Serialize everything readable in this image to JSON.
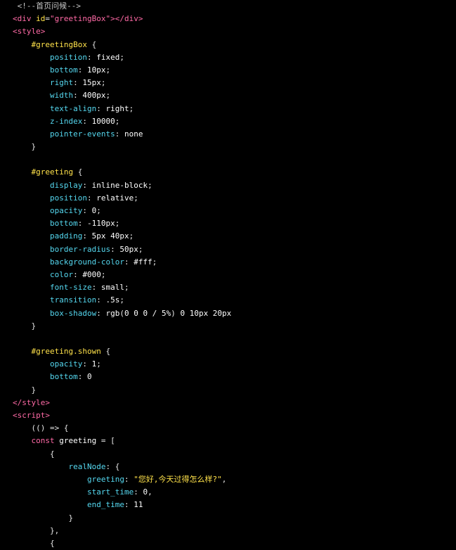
{
  "editor": {
    "background": "#000000",
    "colors": {
      "tag": "#ff6aa6",
      "attribute": "#ffe24a",
      "selector": "#ffe24a",
      "property": "#55d8f0",
      "value": "#ffffff",
      "comment": "#c8c8c8"
    },
    "lines": [
      [
        [
          "comment",
          " <!--首页问候-->"
        ]
      ],
      [
        [
          "tag",
          "<div"
        ],
        [
          "punct",
          " "
        ],
        [
          "attr",
          "id"
        ],
        [
          "punct",
          "="
        ],
        [
          "string",
          "\"greetingBox\""
        ],
        [
          "tag",
          "></div>"
        ]
      ],
      [
        [
          "tag",
          "<style>"
        ]
      ],
      [
        [
          "punct",
          "    "
        ],
        [
          "selector",
          "#greetingBox"
        ],
        [
          "punct",
          " {"
        ]
      ],
      [
        [
          "punct",
          "        "
        ],
        [
          "prop",
          "position"
        ],
        [
          "punct",
          ": "
        ],
        [
          "value",
          "fixed"
        ],
        [
          "punct",
          ";"
        ]
      ],
      [
        [
          "punct",
          "        "
        ],
        [
          "prop",
          "bottom"
        ],
        [
          "punct",
          ": "
        ],
        [
          "value",
          "10px"
        ],
        [
          "punct",
          ";"
        ]
      ],
      [
        [
          "punct",
          "        "
        ],
        [
          "prop",
          "right"
        ],
        [
          "punct",
          ": "
        ],
        [
          "value",
          "15px"
        ],
        [
          "punct",
          ";"
        ]
      ],
      [
        [
          "punct",
          "        "
        ],
        [
          "prop",
          "width"
        ],
        [
          "punct",
          ": "
        ],
        [
          "value",
          "400px"
        ],
        [
          "punct",
          ";"
        ]
      ],
      [
        [
          "punct",
          "        "
        ],
        [
          "prop",
          "text-align"
        ],
        [
          "punct",
          ": "
        ],
        [
          "value",
          "right"
        ],
        [
          "punct",
          ";"
        ]
      ],
      [
        [
          "punct",
          "        "
        ],
        [
          "prop",
          "z-index"
        ],
        [
          "punct",
          ": "
        ],
        [
          "value",
          "10000"
        ],
        [
          "punct",
          ";"
        ]
      ],
      [
        [
          "punct",
          "        "
        ],
        [
          "prop",
          "pointer-events"
        ],
        [
          "punct",
          ": "
        ],
        [
          "value",
          "none"
        ]
      ],
      [
        [
          "punct",
          "    }"
        ]
      ],
      [
        [
          "punct",
          ""
        ]
      ],
      [
        [
          "punct",
          "    "
        ],
        [
          "selector",
          "#greeting"
        ],
        [
          "punct",
          " {"
        ]
      ],
      [
        [
          "punct",
          "        "
        ],
        [
          "prop",
          "display"
        ],
        [
          "punct",
          ": "
        ],
        [
          "value",
          "inline-block"
        ],
        [
          "punct",
          ";"
        ]
      ],
      [
        [
          "punct",
          "        "
        ],
        [
          "prop",
          "position"
        ],
        [
          "punct",
          ": "
        ],
        [
          "value",
          "relative"
        ],
        [
          "punct",
          ";"
        ]
      ],
      [
        [
          "punct",
          "        "
        ],
        [
          "prop",
          "opacity"
        ],
        [
          "punct",
          ": "
        ],
        [
          "value",
          "0"
        ],
        [
          "punct",
          ";"
        ]
      ],
      [
        [
          "punct",
          "        "
        ],
        [
          "prop",
          "bottom"
        ],
        [
          "punct",
          ": "
        ],
        [
          "value",
          "-110px"
        ],
        [
          "punct",
          ";"
        ]
      ],
      [
        [
          "punct",
          "        "
        ],
        [
          "prop",
          "padding"
        ],
        [
          "punct",
          ": "
        ],
        [
          "value",
          "5px 40px"
        ],
        [
          "punct",
          ";"
        ]
      ],
      [
        [
          "punct",
          "        "
        ],
        [
          "prop",
          "border-radius"
        ],
        [
          "punct",
          ": "
        ],
        [
          "value",
          "50px"
        ],
        [
          "punct",
          ";"
        ]
      ],
      [
        [
          "punct",
          "        "
        ],
        [
          "prop",
          "background-color"
        ],
        [
          "punct",
          ": "
        ],
        [
          "value",
          "#fff"
        ],
        [
          "punct",
          ";"
        ]
      ],
      [
        [
          "punct",
          "        "
        ],
        [
          "prop",
          "color"
        ],
        [
          "punct",
          ": "
        ],
        [
          "value",
          "#000"
        ],
        [
          "punct",
          ";"
        ]
      ],
      [
        [
          "punct",
          "        "
        ],
        [
          "prop",
          "font-size"
        ],
        [
          "punct",
          ": "
        ],
        [
          "value",
          "small"
        ],
        [
          "punct",
          ";"
        ]
      ],
      [
        [
          "punct",
          "        "
        ],
        [
          "prop",
          "transition"
        ],
        [
          "punct",
          ": "
        ],
        [
          "value",
          ".5s"
        ],
        [
          "punct",
          ";"
        ]
      ],
      [
        [
          "punct",
          "        "
        ],
        [
          "prop",
          "box-shadow"
        ],
        [
          "punct",
          ": "
        ],
        [
          "value",
          "rgb"
        ],
        [
          "punct",
          "("
        ],
        [
          "value",
          "0 0 0 / 5%"
        ],
        [
          "punct",
          ") "
        ],
        [
          "value",
          "0 10px 20px"
        ]
      ],
      [
        [
          "punct",
          "    }"
        ]
      ],
      [
        [
          "punct",
          ""
        ]
      ],
      [
        [
          "punct",
          "    "
        ],
        [
          "selector",
          "#greeting.shown"
        ],
        [
          "punct",
          " {"
        ]
      ],
      [
        [
          "punct",
          "        "
        ],
        [
          "prop",
          "opacity"
        ],
        [
          "punct",
          ": "
        ],
        [
          "value",
          "1"
        ],
        [
          "punct",
          ";"
        ]
      ],
      [
        [
          "punct",
          "        "
        ],
        [
          "prop",
          "bottom"
        ],
        [
          "punct",
          ": "
        ],
        [
          "value",
          "0"
        ]
      ],
      [
        [
          "punct",
          "    }"
        ]
      ],
      [
        [
          "tag",
          "</style>"
        ]
      ],
      [
        [
          "tag",
          "<script>"
        ]
      ],
      [
        [
          "punct",
          "    (() => {"
        ]
      ],
      [
        [
          "punct",
          "    "
        ],
        [
          "keyword",
          "const"
        ],
        [
          "punct",
          " "
        ],
        [
          "ident",
          "greeting"
        ],
        [
          "punct",
          " = ["
        ]
      ],
      [
        [
          "punct",
          "        {"
        ]
      ],
      [
        [
          "punct",
          "            "
        ],
        [
          "key",
          "realNode"
        ],
        [
          "punct",
          ": {"
        ]
      ],
      [
        [
          "punct",
          "                "
        ],
        [
          "key",
          "greeting"
        ],
        [
          "punct",
          ": "
        ],
        [
          "strcn",
          "\"您好,今天过得怎么样?\""
        ],
        [
          "punct",
          ","
        ]
      ],
      [
        [
          "punct",
          "                "
        ],
        [
          "key",
          "start_time"
        ],
        [
          "punct",
          ": "
        ],
        [
          "number",
          "0"
        ],
        [
          "punct",
          ","
        ]
      ],
      [
        [
          "punct",
          "                "
        ],
        [
          "key",
          "end_time"
        ],
        [
          "punct",
          ": "
        ],
        [
          "number",
          "11"
        ]
      ],
      [
        [
          "punct",
          "            }"
        ]
      ],
      [
        [
          "punct",
          "        },"
        ]
      ],
      [
        [
          "punct",
          "        {"
        ]
      ]
    ]
  }
}
